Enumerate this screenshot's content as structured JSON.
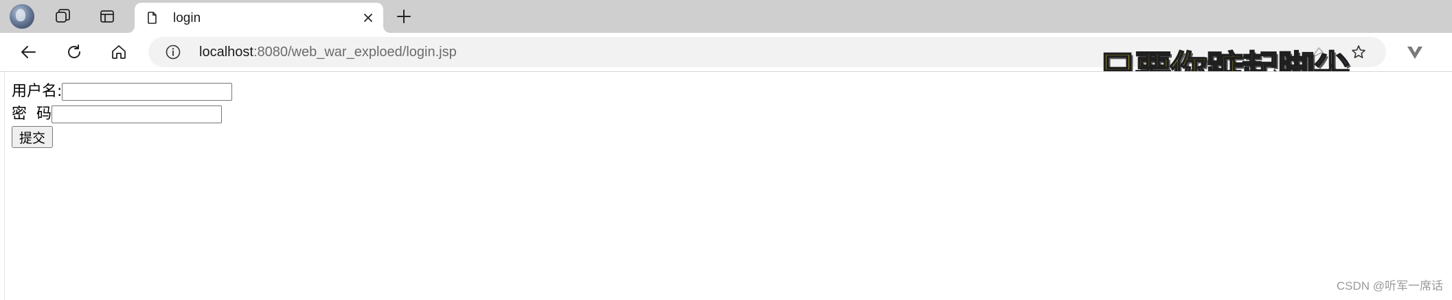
{
  "browser": {
    "tab": {
      "title": "login"
    },
    "address_bar": {
      "url_host": "localhost",
      "url_rest": ":8080/web_war_exploed/login.jsp"
    },
    "overlay_text": {
      "part_a": "只要你踮",
      "part_b": "起脚尖"
    },
    "icons": [
      "avatar",
      "workspaces-icon",
      "vertical-tabs-icon",
      "document-icon",
      "close-icon",
      "plus-icon",
      "back-arrow-icon",
      "refresh-icon",
      "home-icon",
      "info-icon",
      "star-icon",
      "extension-v-icon"
    ]
  },
  "login_form": {
    "username_label": "用户名:",
    "password_label": "密  码",
    "username_value": "",
    "password_value": "",
    "submit_label": "提交"
  },
  "watermark": "CSDN @听军一席话",
  "colors": {
    "tabstrip": "#cfcfcf",
    "omnibox": "#f2f2f2",
    "overlay_yellow": "#f5e23a",
    "overlay_blue": "#4a8fd8"
  }
}
